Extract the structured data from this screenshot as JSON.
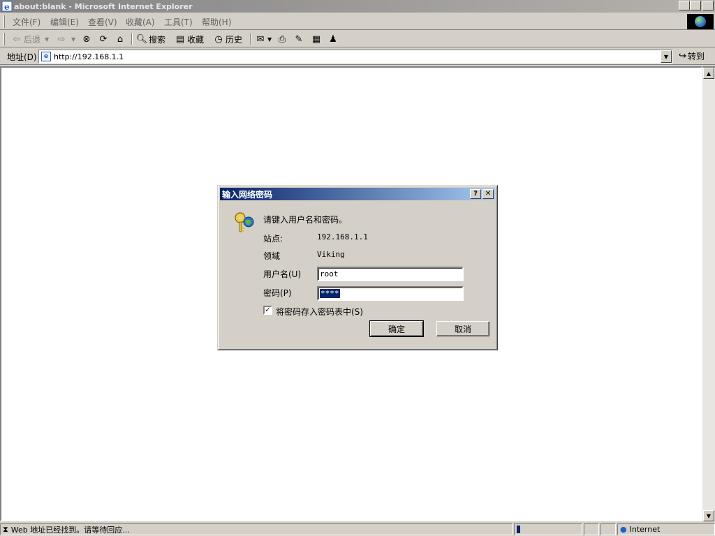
{
  "window": {
    "title": "about:blank - Microsoft Internet Explorer"
  },
  "menu": [
    "文件(F)",
    "编辑(E)",
    "查看(V)",
    "收藏(A)",
    "工具(T)",
    "帮助(H)"
  ],
  "toolbar": {
    "back": "后退",
    "search": "搜索",
    "favorites": "收藏",
    "history": "历史"
  },
  "address": {
    "label": "地址(D)",
    "url": "http://192.168.1.1",
    "go": "转到"
  },
  "dialog": {
    "title": "输入网络密码",
    "prompt": "请键入用户名和密码。",
    "site_label": "站点:",
    "site_value": "192.168.1.1",
    "realm_label": "领域",
    "realm_value": "Viking",
    "user_label": "用户名(U)",
    "user_value": "root",
    "password_label": "密码(P)",
    "password_value": "****",
    "save_label": "将密码存入密码表中(S)",
    "save_checked": true,
    "ok": "确定",
    "cancel": "取消"
  },
  "status": {
    "text": "Web 地址已经找到。请等待回应...",
    "zone": "Internet"
  }
}
